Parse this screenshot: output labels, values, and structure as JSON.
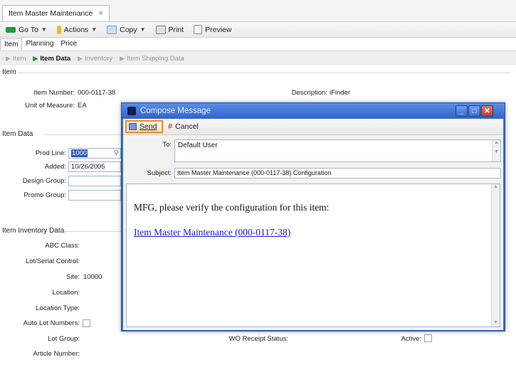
{
  "tab": {
    "title": "Item Master Maintenance",
    "close": "×"
  },
  "toolbar": {
    "goto": "Go To",
    "actions": "Actions",
    "copy": "Copy",
    "print": "Print",
    "preview": "Preview"
  },
  "subtabs": [
    "Item",
    "Planning",
    "Price"
  ],
  "crumbs": [
    "Item",
    "Item Data",
    "Inventory",
    "Item Shipping Data"
  ],
  "item": {
    "section": "Item",
    "item_number_label": "Item Number:",
    "item_number": "000-0117-38",
    "description_label": "Description:",
    "description": "iFinder",
    "uom_label": "Unit of Measure:",
    "uom": "EA"
  },
  "item_data": {
    "section": "Item Data",
    "prod_line_label": "Prod Line:",
    "prod_line": "1000",
    "added_label": "Added:",
    "added": "10/26/2005",
    "design_group_label": "Design Group:",
    "promo_group_label": "Promo Group:"
  },
  "inventory": {
    "section": "Item Inventory Data",
    "abc_label": "ABC Class:",
    "lot_serial_label": "Lot/Serial Control:",
    "site_label": "Site:",
    "site": "10000",
    "location_label": "Location:",
    "location_type_label": "Location Type:",
    "auto_lot_label": "Auto Lot Numbers:",
    "lot_group_label": "Lot Group:",
    "wo_receipt_label": "WO Receipt Status:",
    "active_label": "Active:",
    "article_number_label": "Article Number:"
  },
  "dialog": {
    "title": "Compose Message",
    "send": "Send",
    "cancel": "Cancel",
    "to_label": "To:",
    "to_value": "Default User",
    "subject_label": "Subject:",
    "subject_value": "Item Master Maintenance (000-0117-38) Configuration",
    "body_text": "MFG, please verify the configuration for this item:",
    "body_link": "Item Master Maintenance (000-0117-38)"
  },
  "colors": {
    "accent": "#f08a24",
    "title_bar": "#3a6fcf",
    "link": "#1a1acc"
  }
}
